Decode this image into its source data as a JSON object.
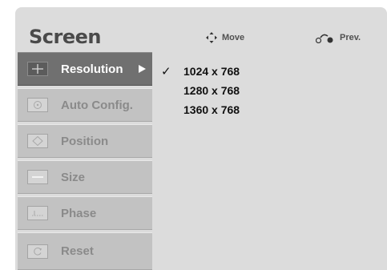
{
  "header": {
    "title": "Screen",
    "hints": [
      {
        "icon": "move-arrows-icon",
        "label": "Move"
      },
      {
        "icon": "return-arrow-icon",
        "label": "Prev."
      }
    ]
  },
  "menu": {
    "items": [
      {
        "label": "Resolution",
        "icon": "resolution-icon",
        "selected": true,
        "has_submenu": true
      },
      {
        "label": "Auto Config.",
        "icon": "auto-config-icon",
        "selected": false
      },
      {
        "label": "Position",
        "icon": "position-icon",
        "selected": false
      },
      {
        "label": "Size",
        "icon": "size-icon",
        "selected": false
      },
      {
        "label": "Phase",
        "icon": "phase-icon",
        "selected": false
      },
      {
        "label": "Reset",
        "icon": "reset-icon",
        "selected": false
      }
    ]
  },
  "submenu": {
    "check_mark": "✓",
    "options": [
      {
        "label": "1024 x 768",
        "checked": true
      },
      {
        "label": "1280 x 768",
        "checked": false
      },
      {
        "label": "1360 x 768",
        "checked": false
      }
    ]
  },
  "colors": {
    "panel_bg": "#dcdcdc",
    "item_bg": "#c2c2c2",
    "item_selected_bg": "#707070",
    "item_text": "#8a8a8a",
    "item_selected_text": "#ffffff"
  }
}
